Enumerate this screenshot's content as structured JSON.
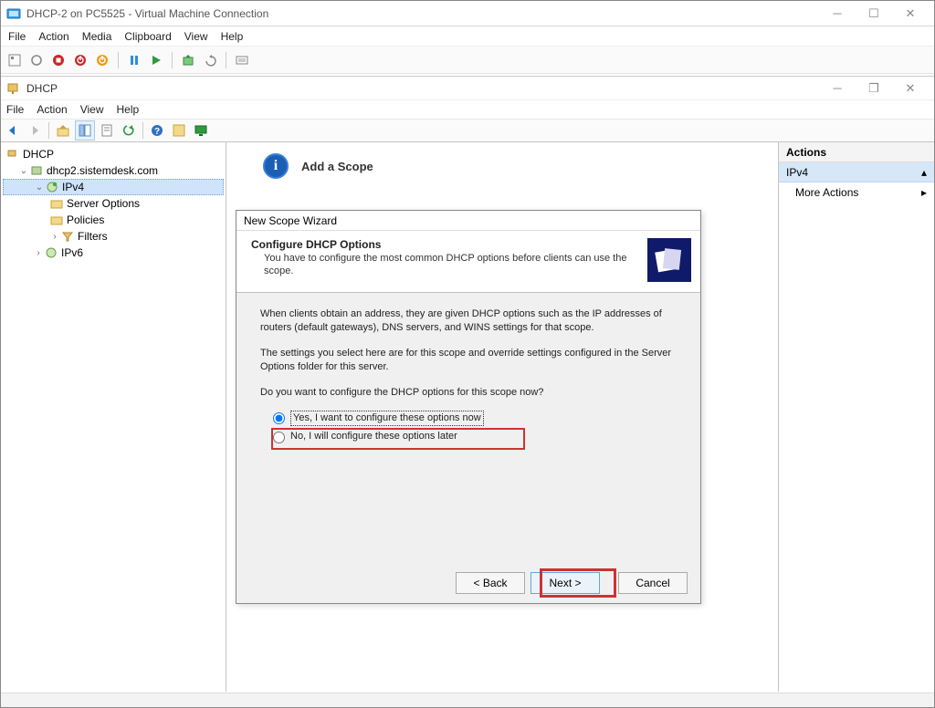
{
  "vm": {
    "title": "DHCP-2 on PC5525 - Virtual Machine Connection",
    "menu": [
      "File",
      "Action",
      "Media",
      "Clipboard",
      "View",
      "Help"
    ]
  },
  "dhcp_window": {
    "title": "DHCP",
    "menu": [
      "File",
      "Action",
      "View",
      "Help"
    ]
  },
  "tree": {
    "root": "DHCP",
    "server": "dhcp2.sistemdesk.com",
    "ipv4": "IPv4",
    "ipv4_children": [
      "Server Options",
      "Policies",
      "Filters"
    ],
    "ipv6": "IPv6"
  },
  "center": {
    "header": "Add a Scope"
  },
  "actions": {
    "title": "Actions",
    "selected": "IPv4",
    "item": "More Actions"
  },
  "wizard": {
    "window_title": "New Scope Wizard",
    "header_title": "Configure DHCP Options",
    "header_sub": "You have to configure the most common DHCP options before clients can use the scope.",
    "p1": "When clients obtain an address, they are given DHCP options such as the IP addresses of routers (default gateways), DNS servers, and WINS settings for that scope.",
    "p2": "The settings you select here are for this scope and override settings configured in the Server Options folder for this server.",
    "p3": "Do you want to configure the DHCP options for this scope now?",
    "opt_yes": "Yes, I want to configure these options now",
    "opt_no": "No, I will configure these options later",
    "btn_back": "< Back",
    "btn_next": "Next >",
    "btn_cancel": "Cancel"
  }
}
